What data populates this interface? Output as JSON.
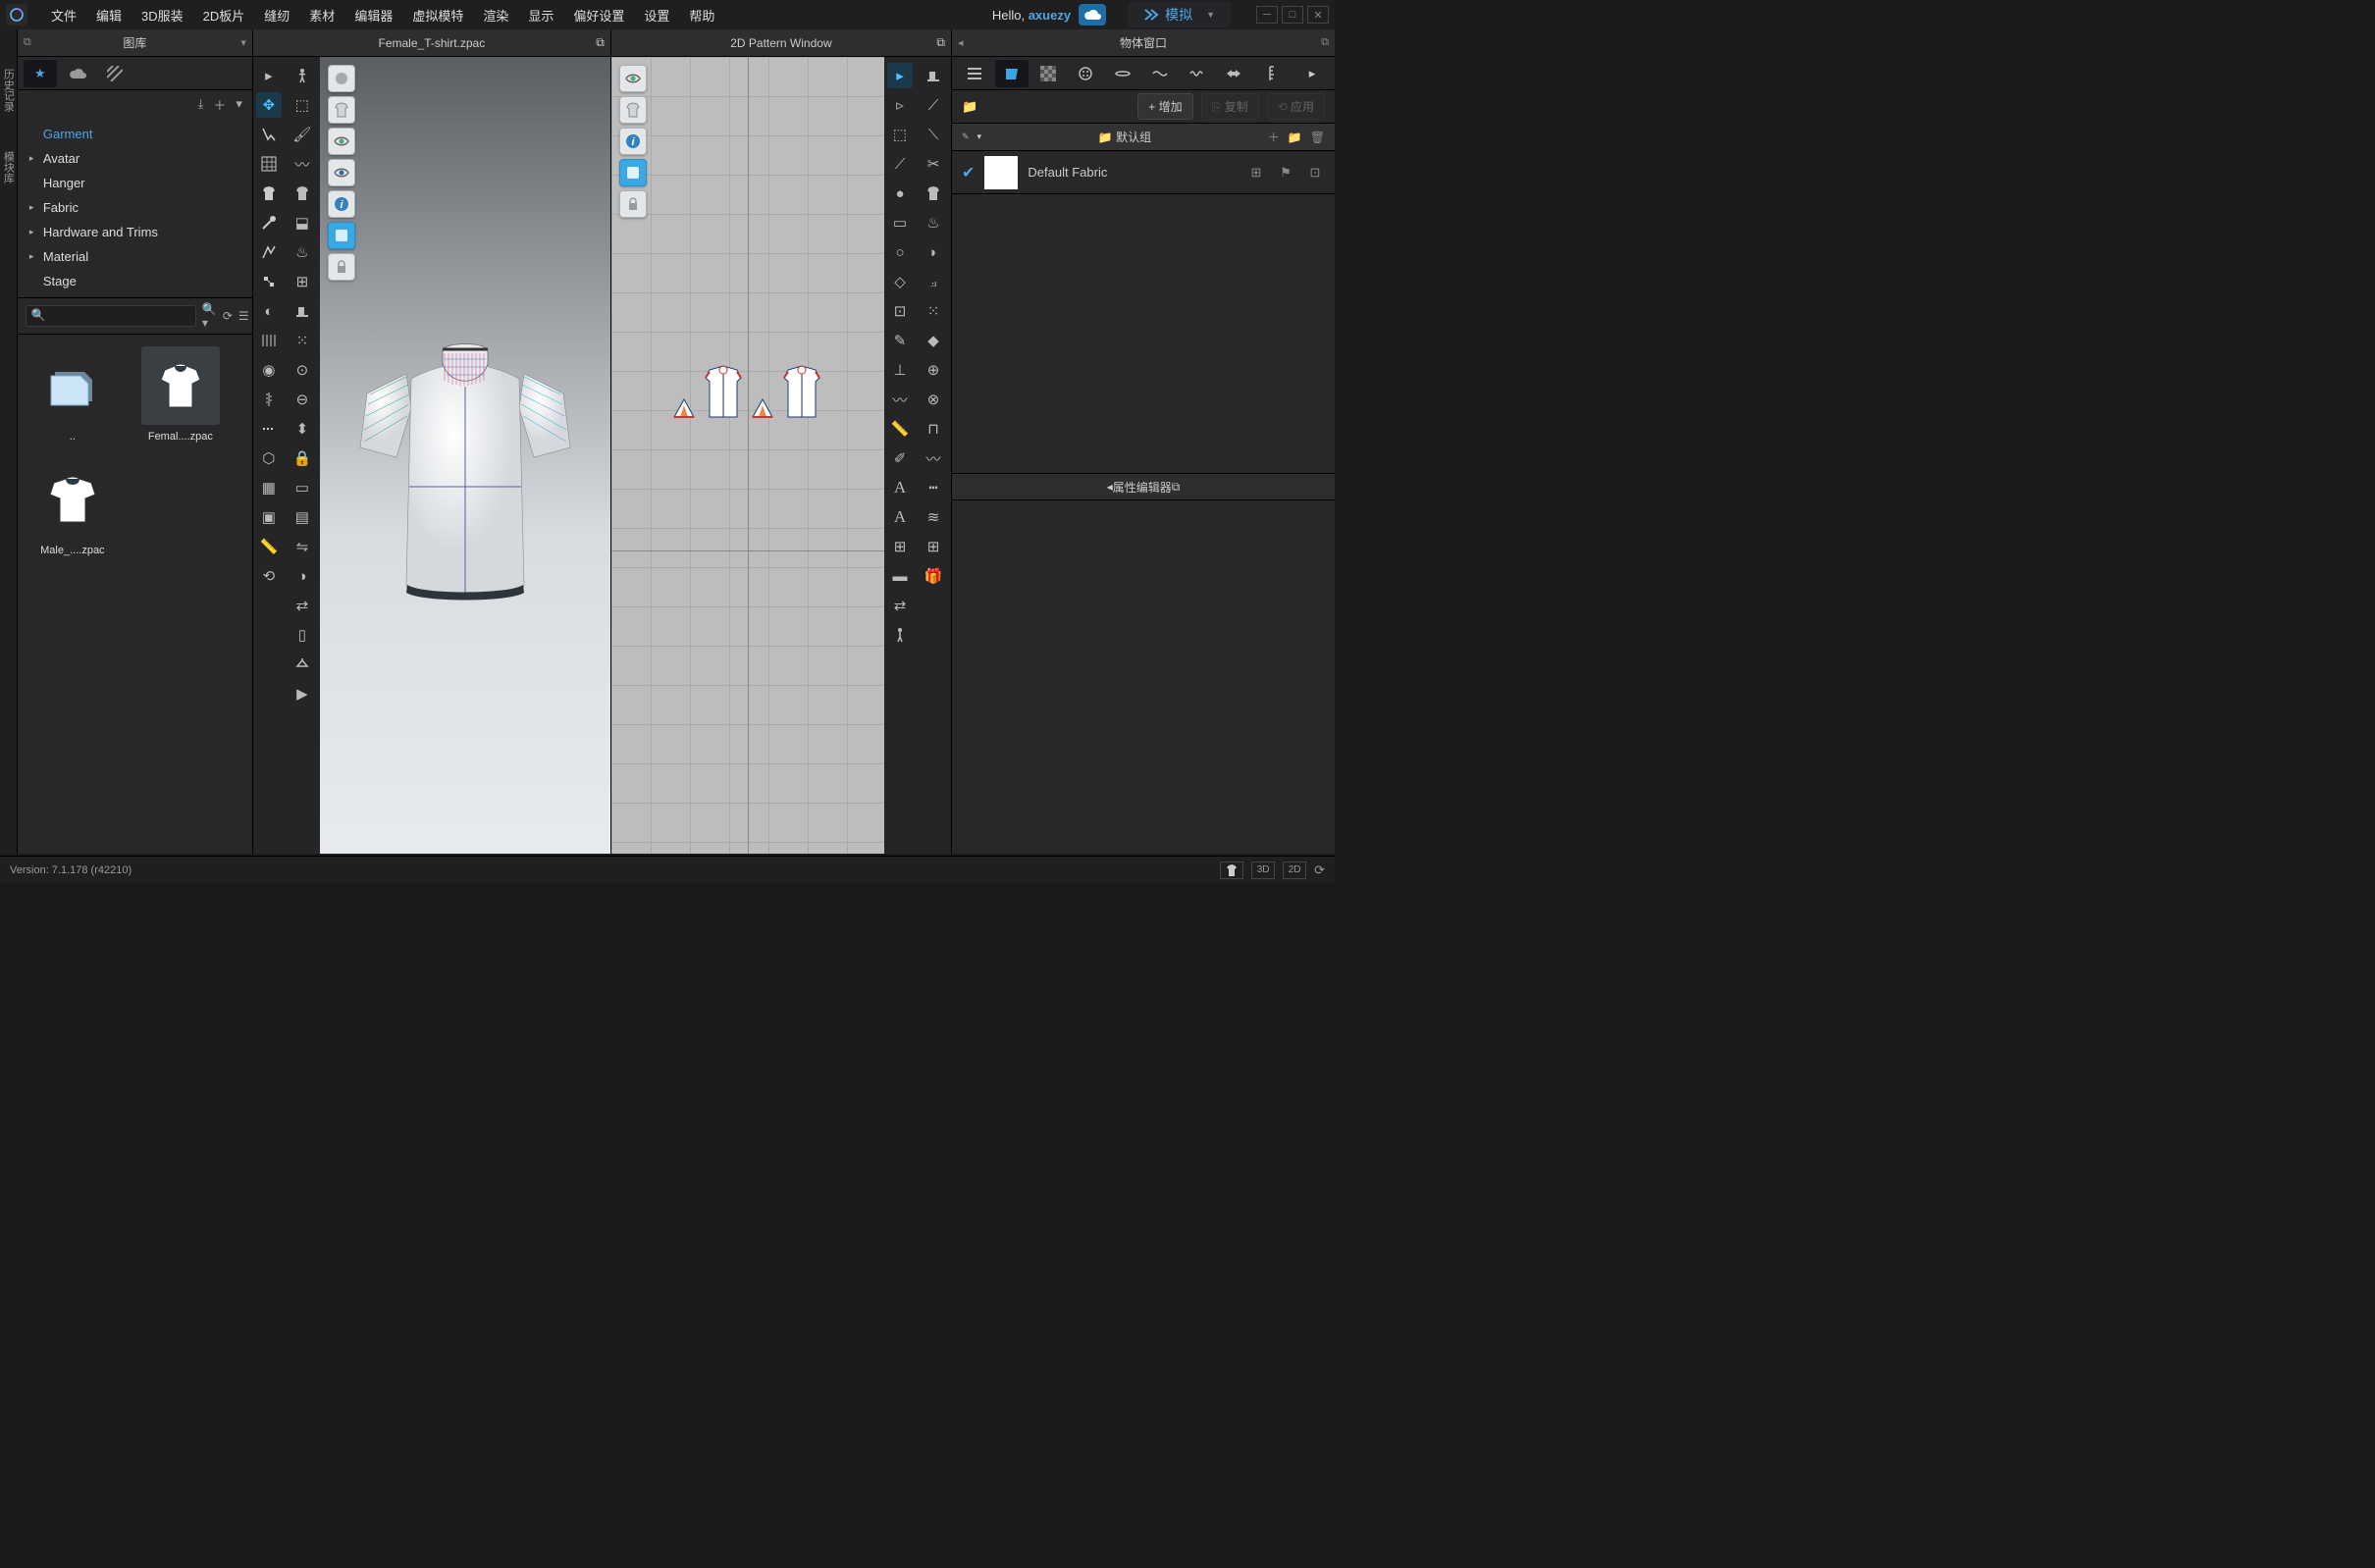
{
  "menubar": {
    "items": [
      "文件",
      "编辑",
      "3D服装",
      "2D板片",
      "缝纫",
      "素材",
      "编辑器",
      "虚拟模特",
      "渲染",
      "显示",
      "偏好设置",
      "设置",
      "帮助"
    ],
    "hello_prefix": "Hello, ",
    "username": "axuezy",
    "simulate": "模拟"
  },
  "side_tabs": {
    "history": "历史记录",
    "modules": "模块库"
  },
  "library": {
    "title": "图库",
    "tree": [
      {
        "label": "Garment",
        "selected": true,
        "expandable": false
      },
      {
        "label": "Avatar",
        "expandable": true
      },
      {
        "label": "Hanger",
        "expandable": false
      },
      {
        "label": "Fabric",
        "expandable": true
      },
      {
        "label": "Hardware and Trims",
        "expandable": true
      },
      {
        "label": "Material",
        "expandable": true
      },
      {
        "label": "Stage",
        "expandable": false
      }
    ],
    "search_placeholder": "",
    "items": [
      {
        "label": "..",
        "kind": "folder"
      },
      {
        "label": "Femal....zpac",
        "kind": "garment",
        "selected": true
      },
      {
        "label": "Male_....zpac",
        "kind": "garment"
      }
    ]
  },
  "views": {
    "d3_title": "Female_T-shirt.zpac",
    "d2_title": "2D Pattern Window"
  },
  "object_window": {
    "title": "物体窗口",
    "add": "+ 增加",
    "copy": "复制",
    "apply": "应用",
    "group": "默认组",
    "fabric": "Default Fabric"
  },
  "property_editor": {
    "title": "属性编辑器"
  },
  "statusbar": {
    "version": "Version: 7.1.178 (r42210)",
    "tag3d": "3D",
    "tag2d": "2D"
  }
}
